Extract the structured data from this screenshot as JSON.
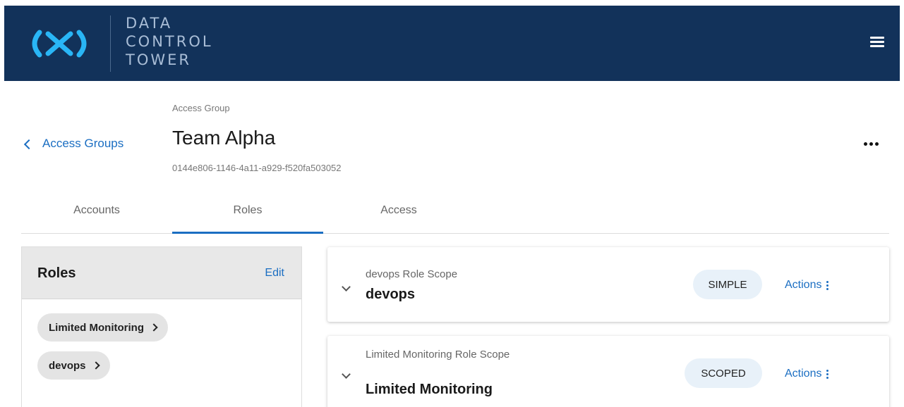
{
  "header": {
    "logo_lines": [
      "DATA",
      "CONTROL",
      "TOWER"
    ],
    "menu_icon": "hamburger-menu-icon"
  },
  "page": {
    "back_label": "Access Groups",
    "kicker": "Access Group",
    "title": "Team Alpha",
    "id": "0144e806-1146-4a11-a929-f520fa503052"
  },
  "tabs": [
    {
      "label": "Accounts"
    },
    {
      "label": "Roles"
    },
    {
      "label": "Access"
    }
  ],
  "active_tab": "Roles",
  "roles_panel": {
    "title": "Roles",
    "edit_label": "Edit",
    "chips": [
      "Limited Monitoring",
      "devops"
    ]
  },
  "role_cards": [
    {
      "subtitle": "devops Role Scope",
      "name": "devops",
      "badge": "SIMPLE",
      "actions_label": "Actions"
    },
    {
      "subtitle": "Limited Monitoring Role Scope",
      "name": "Limited Monitoring",
      "badge": "SCOPED",
      "actions_label": "Actions"
    }
  ],
  "colors": {
    "header_bg": "#12325a",
    "logo_accent": "#29b6f6",
    "link": "#1b6ec2",
    "badge_bg": "#e8f1f9"
  }
}
